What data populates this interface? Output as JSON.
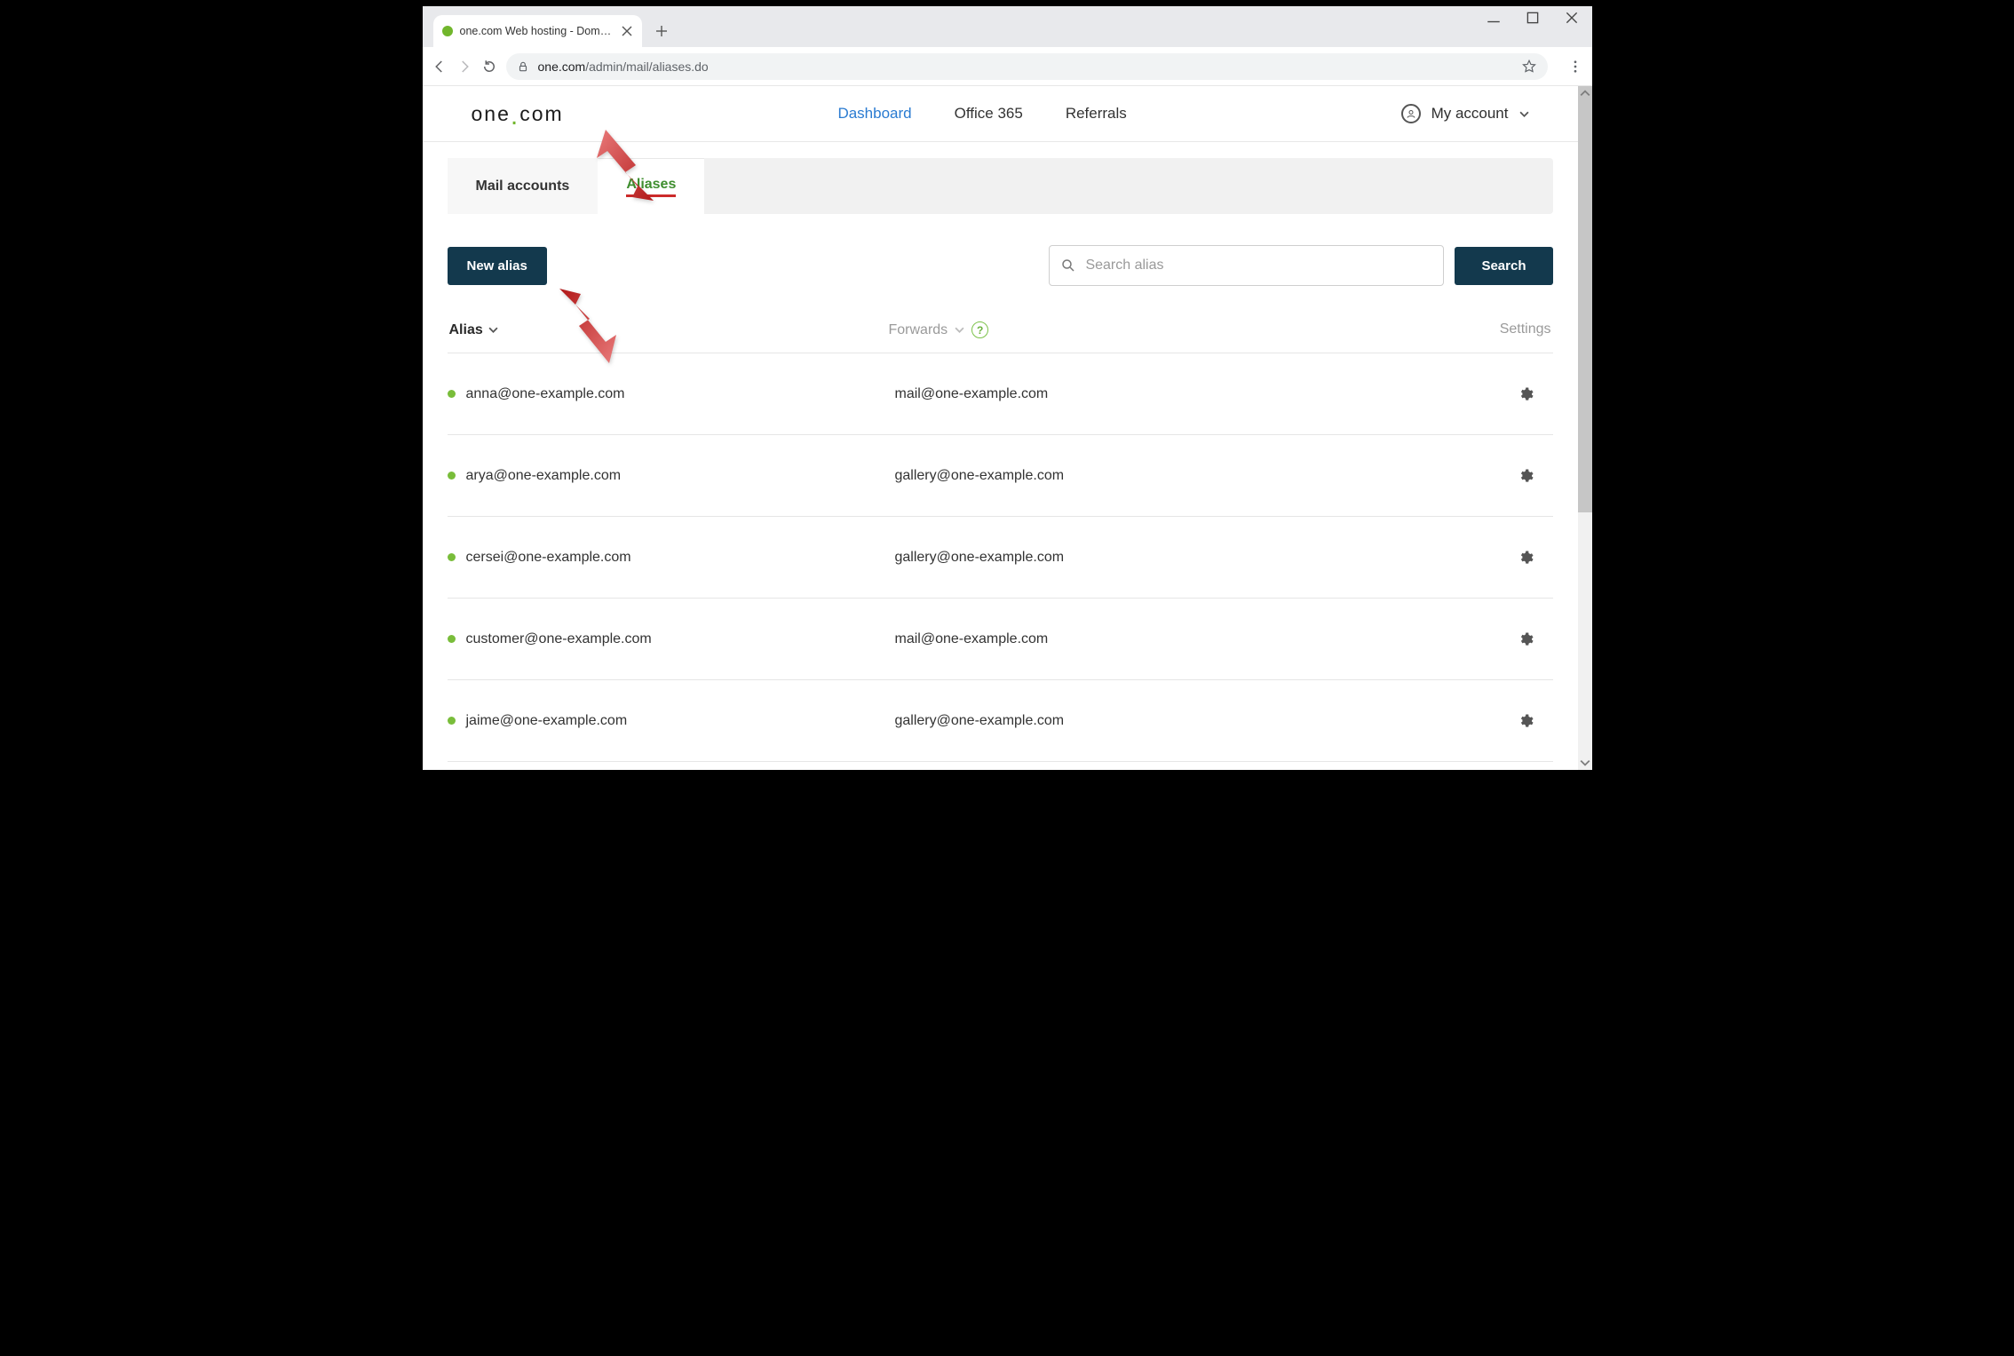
{
  "browser": {
    "tab_title": "one.com Web hosting  -  Domain…",
    "url_domain": "one.com",
    "url_path": "/admin/mail/aliases.do"
  },
  "header": {
    "logo_left": "one",
    "logo_right": "com",
    "nav": {
      "dashboard": "Dashboard",
      "office": "Office 365",
      "referrals": "Referrals"
    },
    "account_label": "My account"
  },
  "tabs": {
    "mail": "Mail accounts",
    "aliases": "Aliases"
  },
  "actions": {
    "new_alias": "New alias",
    "search_placeholder": "Search alias",
    "search_button": "Search"
  },
  "columns": {
    "alias": "Alias",
    "forwards": "Forwards",
    "settings": "Settings"
  },
  "rows": [
    {
      "alias": "anna@one-example.com",
      "forward": "mail@one-example.com"
    },
    {
      "alias": "arya@one-example.com",
      "forward": "gallery@one-example.com"
    },
    {
      "alias": "cersei@one-example.com",
      "forward": "gallery@one-example.com"
    },
    {
      "alias": "customer@one-example.com",
      "forward": "mail@one-example.com"
    },
    {
      "alias": "jaime@one-example.com",
      "forward": "gallery@one-example.com"
    }
  ]
}
